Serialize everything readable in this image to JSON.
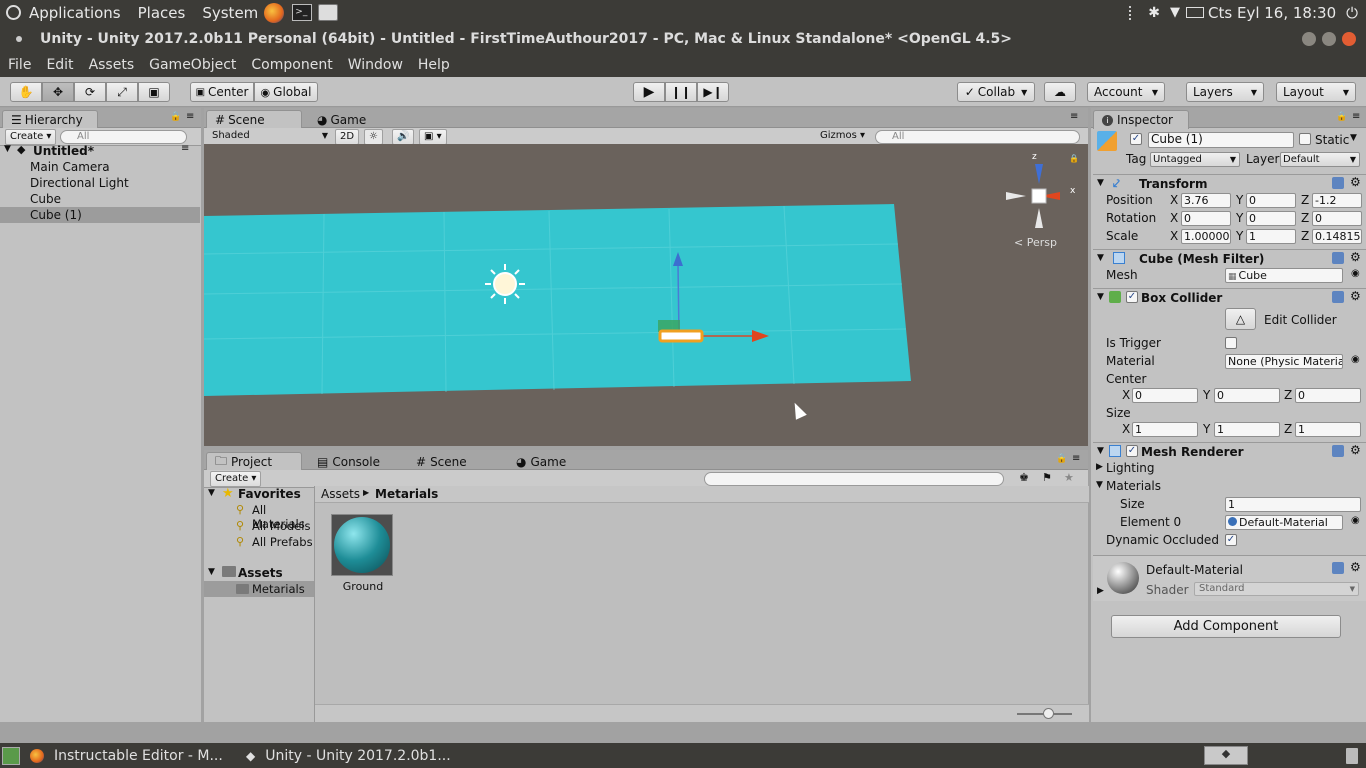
{
  "system_bar": {
    "menus": [
      "Applications",
      "Places",
      "System"
    ],
    "clock": "Cts Eyl 16, 18:30"
  },
  "window": {
    "title": "Unity - Unity 2017.2.0b11 Personal (64bit) - Untitled - FirstTimeAuthour2017 - PC, Mac & Linux Standalone* <OpenGL 4.5>"
  },
  "menu": [
    "File",
    "Edit",
    "Assets",
    "GameObject",
    "Component",
    "Window",
    "Help"
  ],
  "toolbar": {
    "pivot": "Center",
    "space": "Global",
    "collab": "Collab",
    "account": "Account",
    "layers": "Layers",
    "layout": "Layout"
  },
  "hierarchy": {
    "tab": "Hierarchy",
    "create": "Create",
    "search_placeholder": "All",
    "scene": "Untitled*",
    "items": [
      "Main Camera",
      "Directional Light",
      "Cube",
      "Cube (1)"
    ],
    "selected_index": 3
  },
  "scene_view": {
    "tabs": [
      "Scene",
      "Game"
    ],
    "shading": "Shaded",
    "mode_2d": "2D",
    "gizmos": "Gizmos",
    "search_placeholder": "All",
    "persp": "Persp",
    "axis_labels": {
      "y": "z",
      "x": "x"
    }
  },
  "project": {
    "tabs": [
      "Project",
      "Console",
      "Scene",
      "Game"
    ],
    "create": "Create",
    "favorites_label": "Favorites",
    "favorites": [
      "All Materials",
      "All Models",
      "All Prefabs"
    ],
    "assets_label": "Assets",
    "assets_children": [
      "Metarials"
    ],
    "breadcrumb": [
      "Assets",
      "Metarials"
    ],
    "items": [
      {
        "name": "Ground",
        "color": "#1e8d97"
      }
    ]
  },
  "inspector": {
    "tab": "Inspector",
    "object_name": "Cube (1)",
    "static_label": "Static",
    "tag_label": "Tag",
    "tag": "Untagged",
    "layer_label": "Layer",
    "layer": "Default",
    "transform": {
      "title": "Transform",
      "position_label": "Position",
      "rotation_label": "Rotation",
      "scale_label": "Scale",
      "position": {
        "x": "3.76",
        "y": "0",
        "z": "-1.2"
      },
      "rotation": {
        "x": "0",
        "y": "0",
        "z": "0"
      },
      "scale": {
        "x": "1.00000",
        "y": "1",
        "z": "0.14815"
      }
    },
    "mesh_filter": {
      "title": "Cube (Mesh Filter)",
      "mesh_label": "Mesh",
      "mesh": "Cube"
    },
    "box_collider": {
      "title": "Box Collider",
      "edit_label": "Edit Collider",
      "is_trigger_label": "Is Trigger",
      "material_label": "Material",
      "material": "None (Physic Material)",
      "center_label": "Center",
      "center": {
        "x": "0",
        "y": "0",
        "z": "0"
      },
      "size_label": "Size",
      "size": {
        "x": "1",
        "y": "1",
        "z": "1"
      }
    },
    "mesh_renderer": {
      "title": "Mesh Renderer",
      "lighting_label": "Lighting",
      "materials_label": "Materials",
      "size_label": "Size",
      "size": "1",
      "element_label": "Element 0",
      "element": "Default-Material",
      "occluded_label": "Dynamic Occluded"
    },
    "material": {
      "name": "Default-Material",
      "shader_label": "Shader",
      "shader": "Standard"
    },
    "add_component": "Add Component"
  },
  "taskbar": {
    "items": [
      "Instructable Editor - M...",
      "Unity - Unity 2017.2.0b1..."
    ]
  },
  "colors": {
    "plane": "#35c6cf",
    "scene_bg": "#6a625c",
    "chrome": "#3c3b37",
    "panel": "#c2c2c2"
  }
}
